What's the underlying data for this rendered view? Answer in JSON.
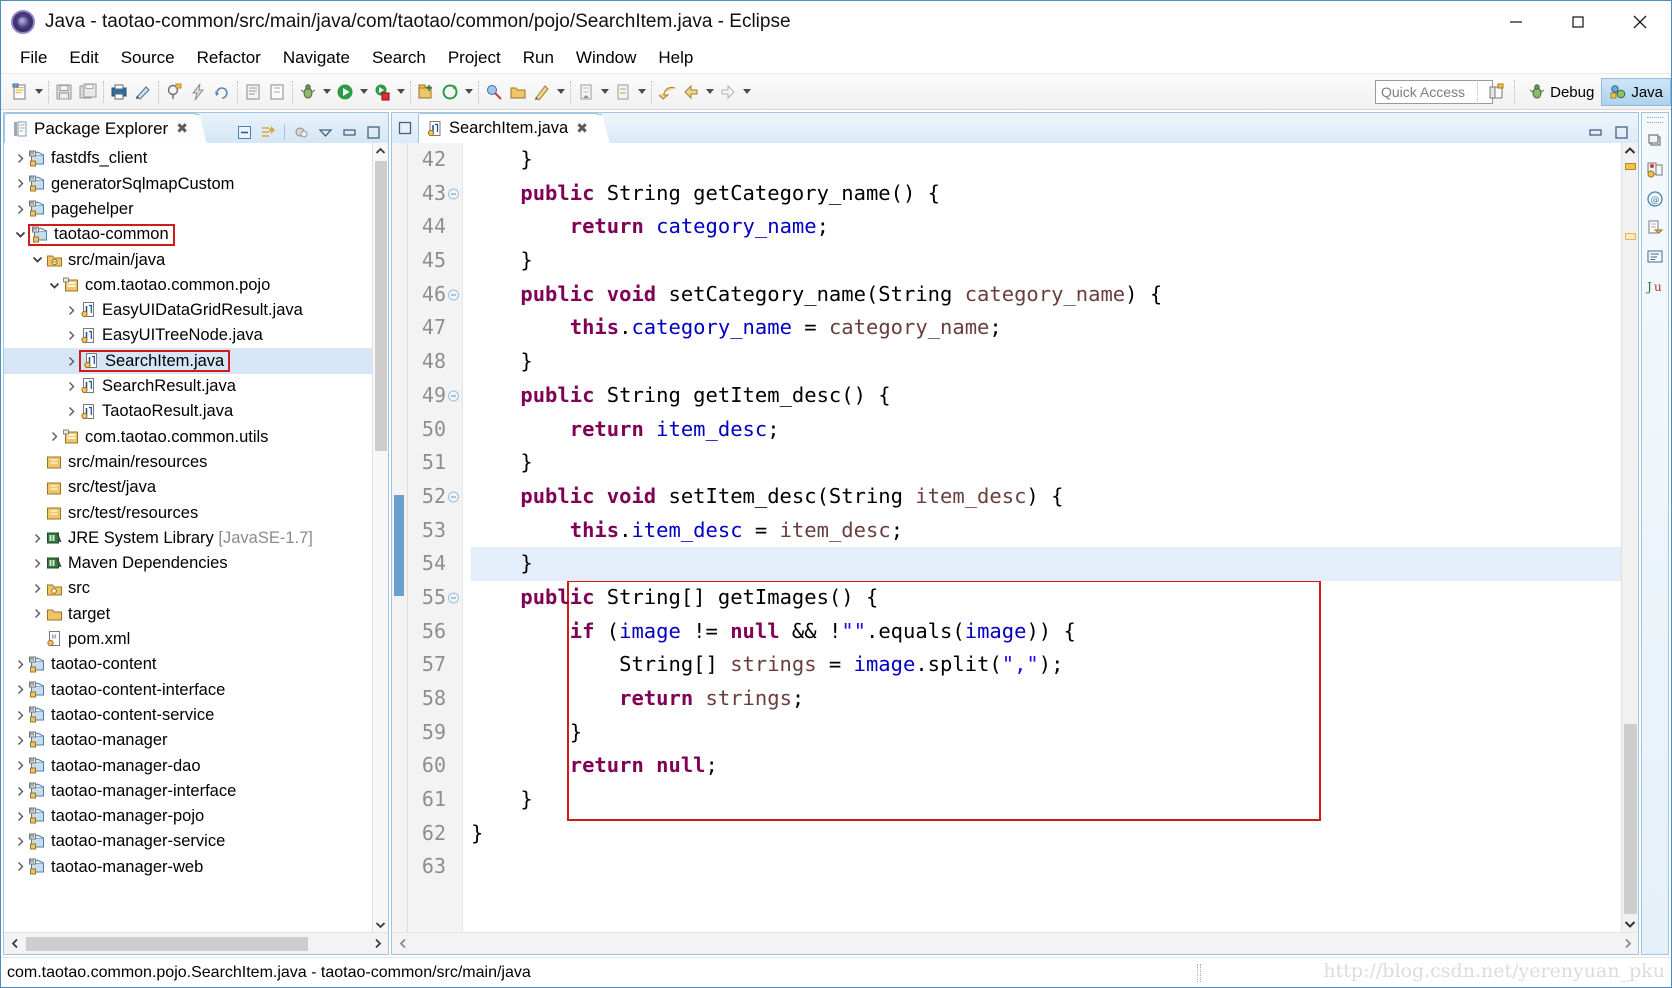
{
  "window": {
    "title": "Java - taotao-common/src/main/java/com/taotao/common/pojo/SearchItem.java - Eclipse",
    "app_icon": "eclipse-icon",
    "controls": {
      "minimize": "minimize-icon",
      "maximize": "maximize-icon",
      "close": "close-icon"
    }
  },
  "menubar": {
    "items": [
      "File",
      "Edit",
      "Source",
      "Refactor",
      "Navigate",
      "Search",
      "Project",
      "Run",
      "Window",
      "Help"
    ]
  },
  "toolbar": {
    "quick_access_placeholder": "Quick Access",
    "open_perspective_icon": "open-perspective-icon",
    "perspectives": [
      {
        "label": "Debug",
        "icon": "debug-perspective-icon",
        "active": false
      },
      {
        "label": "Java",
        "icon": "java-perspective-icon",
        "active": true
      }
    ]
  },
  "explorer": {
    "tab_title": "Package Explorer",
    "close_icon": "close-icon",
    "tools": [
      "collapse-all-icon",
      "link-with-editor-icon",
      "focus-on-active-task-icon",
      "view-menu-icon",
      "minimize-icon",
      "maximize-icon"
    ],
    "tree": [
      {
        "label": "fastdfs_client",
        "indent": 0,
        "twisty": "collapsed",
        "icon": "maven-project-icon"
      },
      {
        "label": "generatorSqlmapCustom",
        "indent": 0,
        "twisty": "collapsed",
        "icon": "maven-project-icon"
      },
      {
        "label": "pagehelper",
        "indent": 0,
        "twisty": "collapsed",
        "icon": "maven-project-icon"
      },
      {
        "label": "taotao-common",
        "indent": 0,
        "twisty": "expanded",
        "icon": "maven-project-icon",
        "highlight_box": true
      },
      {
        "label": "src/main/java",
        "indent": 1,
        "twisty": "expanded",
        "icon": "source-folder-icon"
      },
      {
        "label": "com.taotao.common.pojo",
        "indent": 2,
        "twisty": "expanded",
        "icon": "package-icon"
      },
      {
        "label": "EasyUIDataGridResult.java",
        "indent": 3,
        "twisty": "collapsed",
        "icon": "java-file-icon"
      },
      {
        "label": "EasyUITreeNode.java",
        "indent": 3,
        "twisty": "collapsed",
        "icon": "java-file-icon"
      },
      {
        "label": "SearchItem.java",
        "indent": 3,
        "twisty": "collapsed",
        "icon": "java-file-icon",
        "selected": true,
        "highlight_box": true
      },
      {
        "label": "SearchResult.java",
        "indent": 3,
        "twisty": "collapsed",
        "icon": "java-file-icon"
      },
      {
        "label": "TaotaoResult.java",
        "indent": 3,
        "twisty": "collapsed",
        "icon": "java-file-icon"
      },
      {
        "label": "com.taotao.common.utils",
        "indent": 2,
        "twisty": "collapsed",
        "icon": "package-icon"
      },
      {
        "label": "src/main/resources",
        "indent": 1,
        "twisty": "none",
        "icon": "package-folder-icon"
      },
      {
        "label": "src/test/java",
        "indent": 1,
        "twisty": "none",
        "icon": "package-folder-icon"
      },
      {
        "label": "src/test/resources",
        "indent": 1,
        "twisty": "none",
        "icon": "package-folder-icon"
      },
      {
        "label": "JRE System Library",
        "suffix": " [JavaSE-1.7]",
        "indent": 1,
        "twisty": "collapsed",
        "icon": "library-icon"
      },
      {
        "label": "Maven Dependencies",
        "indent": 1,
        "twisty": "collapsed",
        "icon": "library-icon"
      },
      {
        "label": "src",
        "indent": 1,
        "twisty": "collapsed",
        "icon": "folder-source-icon"
      },
      {
        "label": "target",
        "indent": 1,
        "twisty": "collapsed",
        "icon": "folder-icon"
      },
      {
        "label": "pom.xml",
        "indent": 1,
        "twisty": "none",
        "icon": "xml-file-icon"
      },
      {
        "label": "taotao-content",
        "indent": 0,
        "twisty": "collapsed",
        "icon": "maven-project-icon"
      },
      {
        "label": "taotao-content-interface",
        "indent": 0,
        "twisty": "collapsed",
        "icon": "maven-project-icon"
      },
      {
        "label": "taotao-content-service",
        "indent": 0,
        "twisty": "collapsed",
        "icon": "maven-project-icon"
      },
      {
        "label": "taotao-manager",
        "indent": 0,
        "twisty": "collapsed",
        "icon": "maven-project-icon"
      },
      {
        "label": "taotao-manager-dao",
        "indent": 0,
        "twisty": "collapsed",
        "icon": "maven-project-icon"
      },
      {
        "label": "taotao-manager-interface",
        "indent": 0,
        "twisty": "collapsed",
        "icon": "maven-project-icon"
      },
      {
        "label": "taotao-manager-pojo",
        "indent": 0,
        "twisty": "collapsed",
        "icon": "maven-project-icon"
      },
      {
        "label": "taotao-manager-service",
        "indent": 0,
        "twisty": "collapsed",
        "icon": "maven-project-icon"
      },
      {
        "label": "taotao-manager-web",
        "indent": 0,
        "twisty": "collapsed",
        "icon": "maven-project-icon"
      }
    ]
  },
  "editor": {
    "tab_title": "SearchItem.java",
    "tab_icon": "java-file-icon",
    "close_icon": "close-icon",
    "first_line": 42,
    "highlighted_line": 54,
    "lines": [
      {
        "n": 42,
        "fold": false,
        "tokens": [
          {
            "t": "    }",
            "c": "pln"
          }
        ]
      },
      {
        "n": 43,
        "fold": true,
        "tokens": [
          {
            "t": "    ",
            "c": "pln"
          },
          {
            "t": "public",
            "c": "kw"
          },
          {
            "t": " String getCategory_name() {",
            "c": "pln"
          }
        ]
      },
      {
        "n": 44,
        "fold": false,
        "tokens": [
          {
            "t": "        ",
            "c": "pln"
          },
          {
            "t": "return",
            "c": "kw"
          },
          {
            "t": " ",
            "c": "pln"
          },
          {
            "t": "category_name",
            "c": "fld"
          },
          {
            "t": ";",
            "c": "pln"
          }
        ]
      },
      {
        "n": 45,
        "fold": false,
        "tokens": [
          {
            "t": "    }",
            "c": "pln"
          }
        ]
      },
      {
        "n": 46,
        "fold": true,
        "tokens": [
          {
            "t": "    ",
            "c": "pln"
          },
          {
            "t": "public void",
            "c": "kw"
          },
          {
            "t": " setCategory_name(String ",
            "c": "pln"
          },
          {
            "t": "category_name",
            "c": "par"
          },
          {
            "t": ") {",
            "c": "pln"
          }
        ]
      },
      {
        "n": 47,
        "fold": false,
        "tokens": [
          {
            "t": "        ",
            "c": "pln"
          },
          {
            "t": "this",
            "c": "kw"
          },
          {
            "t": ".",
            "c": "pln"
          },
          {
            "t": "category_name",
            "c": "fld"
          },
          {
            "t": " = ",
            "c": "pln"
          },
          {
            "t": "category_name",
            "c": "par"
          },
          {
            "t": ";",
            "c": "pln"
          }
        ]
      },
      {
        "n": 48,
        "fold": false,
        "tokens": [
          {
            "t": "    }",
            "c": "pln"
          }
        ]
      },
      {
        "n": 49,
        "fold": true,
        "tokens": [
          {
            "t": "    ",
            "c": "pln"
          },
          {
            "t": "public",
            "c": "kw"
          },
          {
            "t": " String getItem_desc() {",
            "c": "pln"
          }
        ]
      },
      {
        "n": 50,
        "fold": false,
        "tokens": [
          {
            "t": "        ",
            "c": "pln"
          },
          {
            "t": "return",
            "c": "kw"
          },
          {
            "t": " ",
            "c": "pln"
          },
          {
            "t": "item_desc",
            "c": "fld"
          },
          {
            "t": ";",
            "c": "pln"
          }
        ]
      },
      {
        "n": 51,
        "fold": false,
        "tokens": [
          {
            "t": "    }",
            "c": "pln"
          }
        ]
      },
      {
        "n": 52,
        "fold": true,
        "tokens": [
          {
            "t": "    ",
            "c": "pln"
          },
          {
            "t": "public void",
            "c": "kw"
          },
          {
            "t": " setItem_desc(String ",
            "c": "pln"
          },
          {
            "t": "item_desc",
            "c": "par"
          },
          {
            "t": ") {",
            "c": "pln"
          }
        ]
      },
      {
        "n": 53,
        "fold": false,
        "tokens": [
          {
            "t": "        ",
            "c": "pln"
          },
          {
            "t": "this",
            "c": "kw"
          },
          {
            "t": ".",
            "c": "pln"
          },
          {
            "t": "item_desc",
            "c": "fld"
          },
          {
            "t": " = ",
            "c": "pln"
          },
          {
            "t": "item_desc",
            "c": "par"
          },
          {
            "t": ";",
            "c": "pln"
          }
        ]
      },
      {
        "n": 54,
        "fold": false,
        "tokens": [
          {
            "t": "    }",
            "c": "pln"
          }
        ]
      },
      {
        "n": 55,
        "fold": true,
        "tokens": [
          {
            "t": "    ",
            "c": "pln"
          },
          {
            "t": "public",
            "c": "kw"
          },
          {
            "t": " String[] getImages() {",
            "c": "pln"
          }
        ]
      },
      {
        "n": 56,
        "fold": false,
        "tokens": [
          {
            "t": "        ",
            "c": "pln"
          },
          {
            "t": "if",
            "c": "kw"
          },
          {
            "t": " (",
            "c": "pln"
          },
          {
            "t": "image",
            "c": "fld"
          },
          {
            "t": " != ",
            "c": "pln"
          },
          {
            "t": "null",
            "c": "kw"
          },
          {
            "t": " && !",
            "c": "pln"
          },
          {
            "t": "\"\"",
            "c": "str"
          },
          {
            "t": ".equals(",
            "c": "pln"
          },
          {
            "t": "image",
            "c": "fld"
          },
          {
            "t": ")) {",
            "c": "pln"
          }
        ]
      },
      {
        "n": 57,
        "fold": false,
        "tokens": [
          {
            "t": "            String[] ",
            "c": "pln"
          },
          {
            "t": "strings",
            "c": "loc"
          },
          {
            "t": " = ",
            "c": "pln"
          },
          {
            "t": "image",
            "c": "fld"
          },
          {
            "t": ".split(",
            "c": "pln"
          },
          {
            "t": "\",\"",
            "c": "str"
          },
          {
            "t": ");",
            "c": "pln"
          }
        ]
      },
      {
        "n": 58,
        "fold": false,
        "tokens": [
          {
            "t": "            ",
            "c": "pln"
          },
          {
            "t": "return",
            "c": "kw"
          },
          {
            "t": " ",
            "c": "pln"
          },
          {
            "t": "strings",
            "c": "loc"
          },
          {
            "t": ";",
            "c": "pln"
          }
        ]
      },
      {
        "n": 59,
        "fold": false,
        "tokens": [
          {
            "t": "        }",
            "c": "pln"
          }
        ]
      },
      {
        "n": 60,
        "fold": false,
        "tokens": [
          {
            "t": "        ",
            "c": "pln"
          },
          {
            "t": "return null",
            "c": "kw"
          },
          {
            "t": ";",
            "c": "pln"
          }
        ]
      },
      {
        "n": 61,
        "fold": false,
        "tokens": [
          {
            "t": "    }",
            "c": "pln"
          }
        ]
      },
      {
        "n": 62,
        "fold": false,
        "tokens": [
          {
            "t": "}",
            "c": "pln"
          }
        ]
      },
      {
        "n": 63,
        "fold": false,
        "tokens": [
          {
            "t": "",
            "c": "pln"
          }
        ]
      }
    ]
  },
  "fastbar": {
    "items": [
      "restore-icon",
      "problems-icon",
      "at-icon",
      "task-icon",
      "console-icon",
      "junit-icon"
    ]
  },
  "statusbar": {
    "text": "com.taotao.common.pojo.SearchItem.java - taotao-common/src/main/java",
    "watermark": "http://blog.csdn.net/yerenyuan_pku"
  },
  "colors": {
    "keyword": "#7f0055",
    "field": "#0000c0",
    "string": "#2a00ff",
    "parameter": "#6a3e3e",
    "selection": "#d6e6f7",
    "highlight_box": "#d01b1b",
    "window_border": "#4a8fc0"
  }
}
